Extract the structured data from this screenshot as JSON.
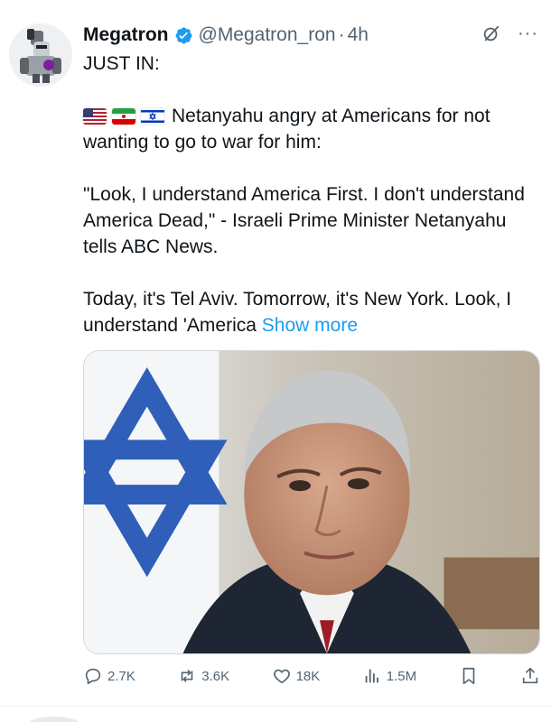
{
  "tweet": {
    "display_name": "Megatron",
    "handle": "@Megatron_ron",
    "separator": "·",
    "time": "4h",
    "icons": {
      "avatar": "megatron-avatar",
      "verified": "verified-badge-icon",
      "grok": "grok-icon",
      "more": "more-icon"
    },
    "text": {
      "line1": "JUST IN:",
      "flags": [
        "us-flag",
        "iran-flag",
        "israel-flag"
      ],
      "para1": "Netanyahu angry at Americans for not wanting to go to war for him:",
      "para2": "\"Look, I understand America First. I don't understand America Dead,\" - Israeli Prime Minister Netanyahu tells ABC News.",
      "para3": "Today, it's Tel Aviv. Tomorrow, it's New York. Look, I understand 'America",
      "show_more": "Show more"
    },
    "colors": {
      "accent": "#1d9bf0",
      "text": "#0f1419",
      "muted": "#536471"
    }
  },
  "actions": {
    "reply": {
      "icon": "reply-icon",
      "count": "2.7K"
    },
    "repost": {
      "icon": "repost-icon",
      "count": "3.6K"
    },
    "like": {
      "icon": "like-icon",
      "count": "18K"
    },
    "views": {
      "icon": "views-icon",
      "count": "1.5M"
    },
    "bookmark": {
      "icon": "bookmark-icon"
    },
    "share": {
      "icon": "share-icon"
    }
  }
}
